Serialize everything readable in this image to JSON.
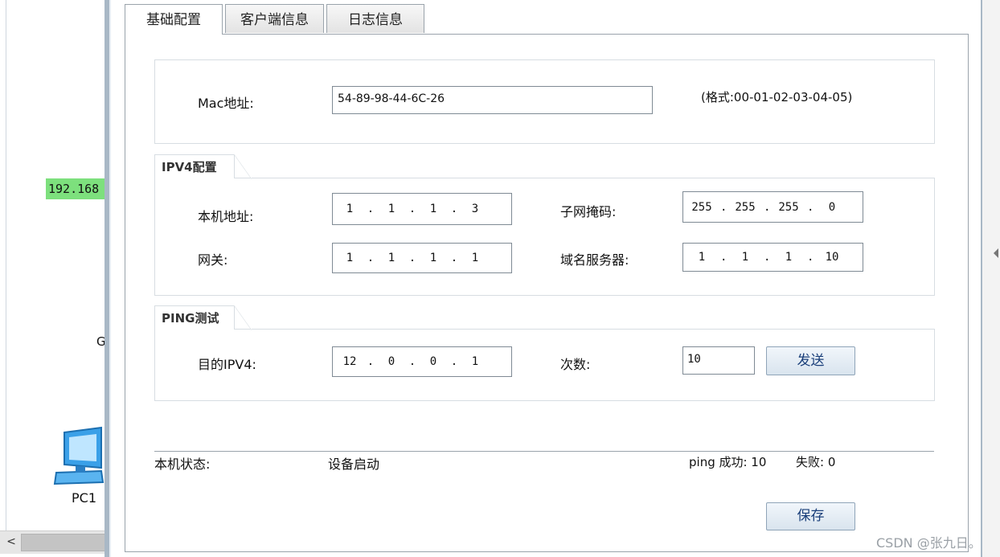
{
  "background": {
    "ip_label": "192.168",
    "g_label": "G",
    "pc_label": "PC1",
    "scroll_left_arrow": "<"
  },
  "tabs": [
    {
      "label": "基础配置",
      "active": true
    },
    {
      "label": "客户端信息",
      "active": false
    },
    {
      "label": "日志信息",
      "active": false
    }
  ],
  "mac": {
    "label": "Mac地址:",
    "value": "54-89-98-44-6C-26",
    "hint": "(格式:00-01-02-03-04-05)"
  },
  "ipv4": {
    "title": "IPV4配置",
    "local_ip": {
      "label": "本机地址:",
      "octets": [
        "1",
        "1",
        "1",
        "3"
      ]
    },
    "mask": {
      "label": "子网掩码:",
      "octets": [
        "255",
        "255",
        "255",
        "0"
      ]
    },
    "gateway": {
      "label": "网关:",
      "octets": [
        "1",
        "1",
        "1",
        "1"
      ]
    },
    "dns": {
      "label": "域名服务器:",
      "octets": [
        "1",
        "1",
        "1",
        "10"
      ]
    }
  },
  "ping": {
    "title": "PING测试",
    "dest": {
      "label": "目的IPV4:",
      "octets": [
        "12",
        "0",
        "0",
        "1"
      ]
    },
    "count_label": "次数:",
    "count_value": "10",
    "send_label": "发送"
  },
  "status": {
    "label": "本机状态:",
    "value": "设备启动",
    "ping_success": "ping 成功: 10",
    "ping_fail": "失败: 0"
  },
  "save_label": "保存",
  "watermark": "CSDN @张九日。",
  "colors": {
    "ip_label_bg": "#7de07d",
    "button_text": "#1a3f7a",
    "frame": "#a9b8c6"
  }
}
